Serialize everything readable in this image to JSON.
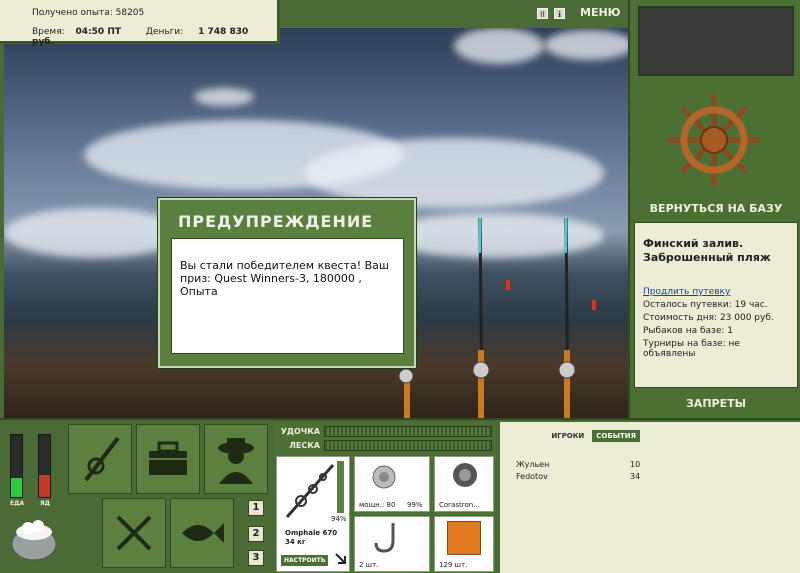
{
  "info": {
    "exp_label": "Получено опыта:",
    "exp_value": "58205",
    "time_label": "Время:",
    "time_value": "04:50 ПТ",
    "money_label": "Деньги:",
    "money_value": "1 748 830 руб."
  },
  "topbar": {
    "pause_label": "II",
    "info_label": "ℹ",
    "menu_label": "МЕНЮ"
  },
  "dialog": {
    "title": "ПРЕДУПРЕЖДЕНИЕ",
    "message": "Вы стали победителем квеста! Ваш приз: Quest Winners-3, 180000 , Опыта"
  },
  "right": {
    "return_label": "ВЕРНУТЬСЯ НА БАЗУ",
    "location": "Финский залив. Заброшенный пляж",
    "extend_link": "Продлить путевку",
    "remaining": "Осталось путевки: 19 час.",
    "day_cost": "Стоимость дня: 23 000 руб.",
    "fishers": "Рыбаков на базе: 1",
    "tournaments": "Турниры на базе: не объявлены",
    "bans_label": "ЗАПРЕТЫ"
  },
  "bottom": {
    "food_label": "ЕДА",
    "poison_label": "ЯД",
    "num1": "1",
    "num2": "2",
    "num3": "3",
    "rod_label": "УДОЧКА",
    "line_label": "ЛЕСКА",
    "rod_name": "Omphale 670",
    "rod_weight": "34 кг",
    "rod_percent": "94%",
    "setup_label": "НАСТРОИТЬ",
    "reel_power": "мощн.: 80",
    "reel_percent": "99%",
    "line_name": "Corastron...",
    "hook_count": "2 шт.",
    "bait_count": "129 шт."
  },
  "stats": {
    "tab_players": "ИГРОКИ",
    "tab_events": "СОБЫТИЯ",
    "players": [
      {
        "name": "Жульен",
        "value": "10"
      },
      {
        "name": "Fedotov",
        "value": "34"
      }
    ]
  },
  "meters": {
    "food": 0.3,
    "poison": 0.35
  },
  "colors": {
    "panel": "#4c7034",
    "cream": "#ededd6",
    "accent_red": "#c0392b",
    "accent_green": "#2ecc40"
  }
}
